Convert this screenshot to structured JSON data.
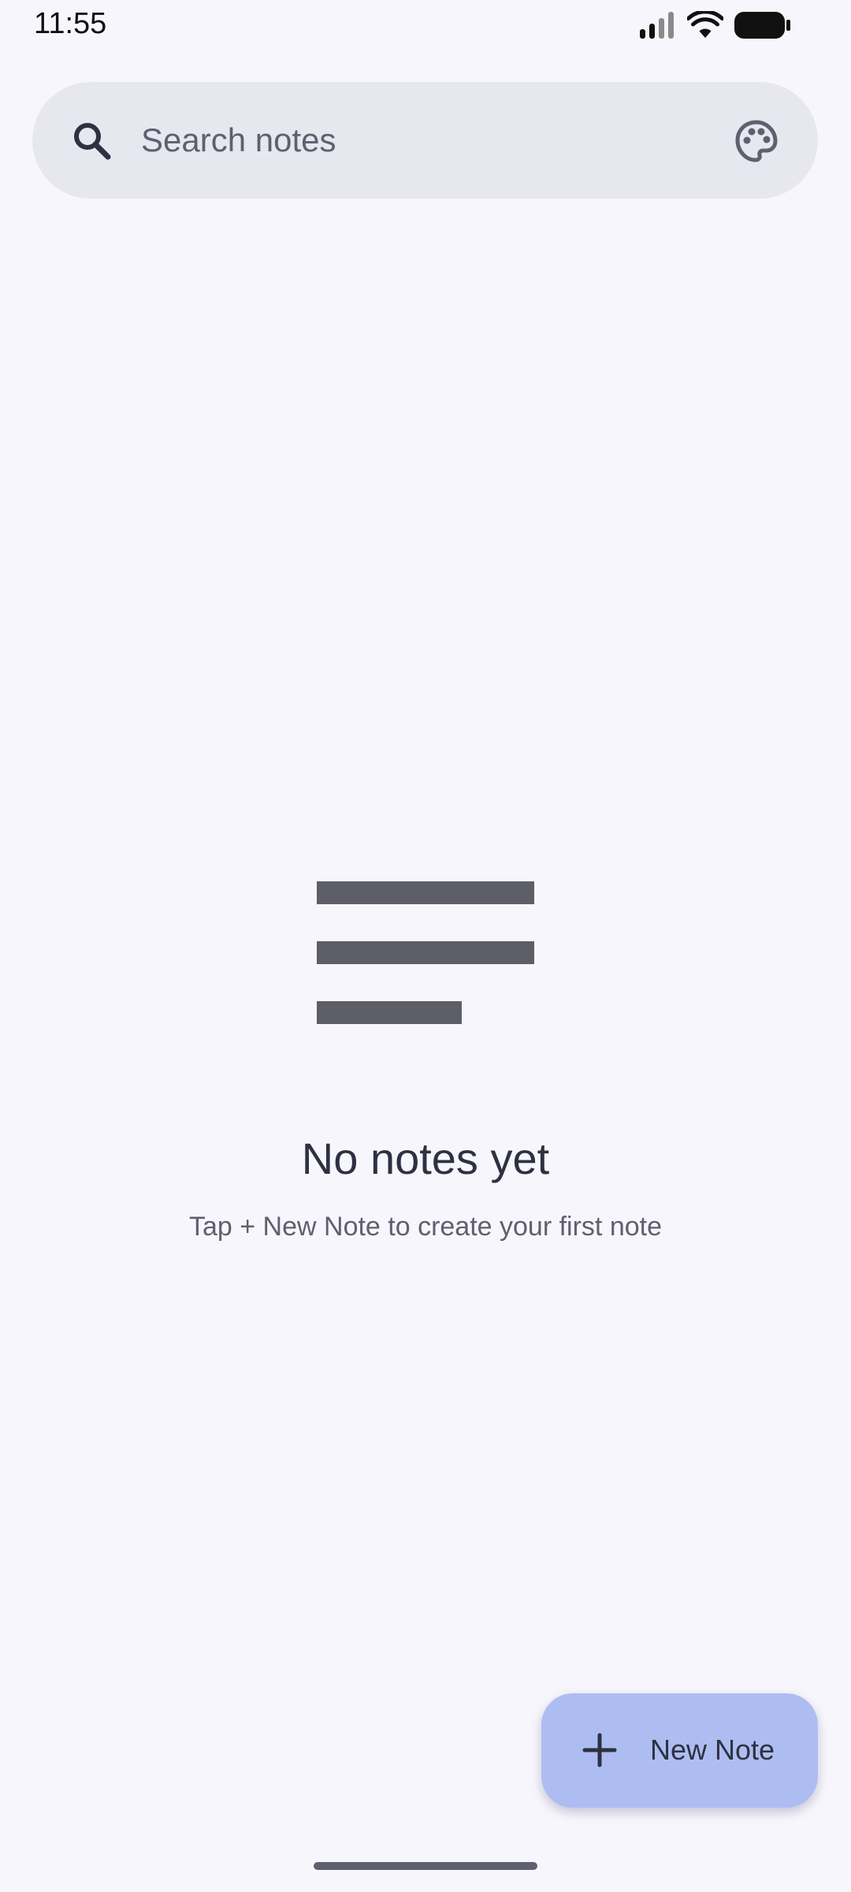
{
  "status_bar": {
    "time": "11:55",
    "icons": [
      "signal-icon",
      "wifi-icon",
      "battery-icon"
    ]
  },
  "search": {
    "placeholder": "Search notes",
    "value": "",
    "icon": "search-icon",
    "action_icon": "palette-icon"
  },
  "empty_state": {
    "icon": "notes-lines-icon",
    "title": "No notes yet",
    "subtitle": "Tap + New Note to create your first note"
  },
  "fab": {
    "icon": "plus-icon",
    "label": "New Note"
  },
  "colors": {
    "background": "#F8F6FD",
    "search_bar": "#E7E7F0",
    "fab": "#AEBDF1",
    "text_primary": "#2D3142",
    "text_secondary": "#5E6070"
  }
}
